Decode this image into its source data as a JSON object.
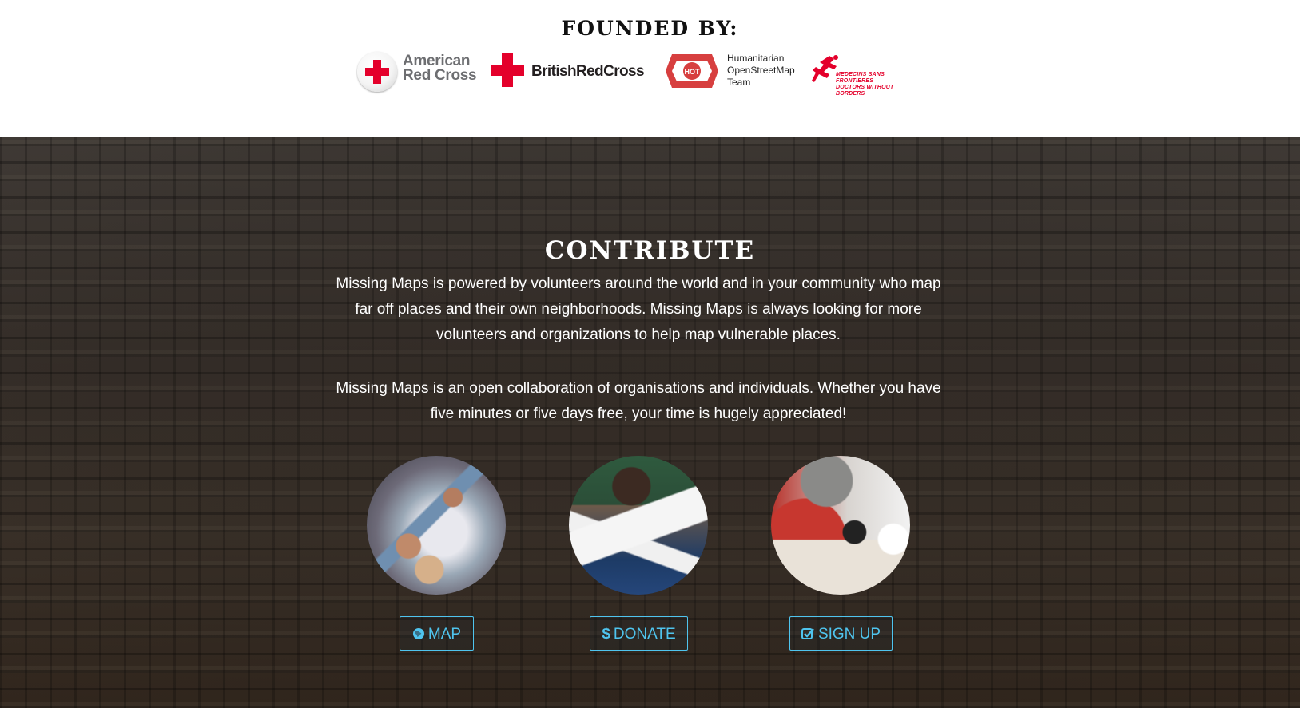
{
  "founded": {
    "title": "FOUNDED BY:",
    "logos": {
      "american_red_cross": {
        "line1": "American",
        "line2": "Red Cross"
      },
      "british_red_cross": {
        "name": "BritishRedCross"
      },
      "hot": {
        "badge": "HOT",
        "line1": "Humanitarian",
        "line2": "OpenStreetMap",
        "line3": "Team"
      },
      "msf": {
        "line1": "MEDECINS SANS FRONTIERES",
        "line2": "DOCTORS WITHOUT BORDERS"
      }
    }
  },
  "contribute": {
    "title": "CONTRIBUTE",
    "paragraph1": "Missing Maps is powered by volunteers around the world and in your community who map far off places and their own neighborhoods. Missing Maps is always looking for more volunteers and organizations to help map vulnerable places.",
    "paragraph2": "Missing Maps is an open collaboration of organisations and individuals. Whether you have five minutes or five days free, your time is hugely appreciated!",
    "actions": [
      {
        "label": "MAP",
        "icon": "globe-icon"
      },
      {
        "label": "DONATE",
        "icon": "dollar-icon"
      },
      {
        "label": "SIGN UP",
        "icon": "checkbox-icon"
      }
    ]
  },
  "colors": {
    "accent": "#4fc4ee",
    "red_cross": "#e4002b",
    "text_light": "#ffffff",
    "text_dark": "#111111"
  }
}
